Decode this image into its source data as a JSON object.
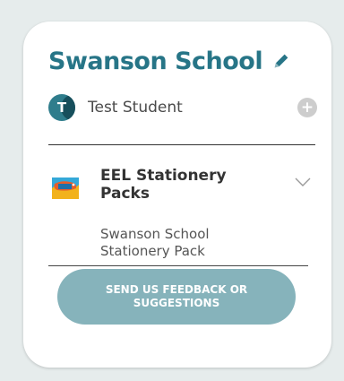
{
  "school": {
    "name": "Swanson School",
    "edit_icon": "pencil-icon"
  },
  "student": {
    "initial": "T",
    "name": "Test Student",
    "add_icon": "plus-icon"
  },
  "pack": {
    "title": "EEL Stationery Packs",
    "subtitle": "Swanson School Stationery Pack",
    "expand_icon": "chevron-down-icon"
  },
  "feedback": {
    "label": "SEND US FEEDBACK OR SUGGESTIONS"
  },
  "colors": {
    "brand": "#277587",
    "button": "#86b3bb",
    "background": "#e6ecec"
  }
}
